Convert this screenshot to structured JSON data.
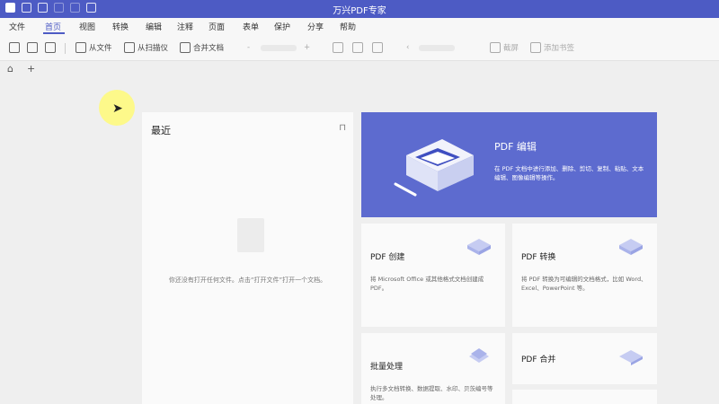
{
  "window": {
    "title": "万兴PDF专家"
  },
  "menu": {
    "items": [
      "文件",
      "首页",
      "视图",
      "转换",
      "编辑",
      "注释",
      "页面",
      "表单",
      "保护",
      "分享",
      "帮助"
    ],
    "active_index": 1
  },
  "toolbar": {
    "from_file": "从文件",
    "from_scanner": "从扫描仪",
    "merge_files": "合并文档",
    "zoom_minus": "-",
    "zoom_plus": "+",
    "prev": "‹",
    "screenshot": "截屏",
    "add_bookmark": "添加书签"
  },
  "tabs": {
    "add": "+"
  },
  "recent": {
    "title": "最近",
    "empty_text": "你还没有打开任何文件。点击“打开文件”打开一个文档。"
  },
  "hero": {
    "title": "PDF 编辑",
    "desc": "在 PDF 文档中进行添加、删除、剪切、复制、粘贴、文本编辑、图像编辑等操作。"
  },
  "cards": [
    {
      "title": "PDF 创建",
      "desc": "将 Microsoft Office 或其他格式文档创建成 PDF。"
    },
    {
      "title": "PDF 转换",
      "desc": "将 PDF 转换为可编辑的文档格式，比如 Word、Excel、PowerPoint 等。"
    },
    {
      "title": "批量处理",
      "desc": "执行多文档转换、数据提取、水印、贝茨编号等处理。"
    },
    {
      "title": "PDF 合并",
      "desc": ""
    }
  ],
  "colors": {
    "accent": "#4d5bc4",
    "hero_bg": "#5d6bcf"
  }
}
